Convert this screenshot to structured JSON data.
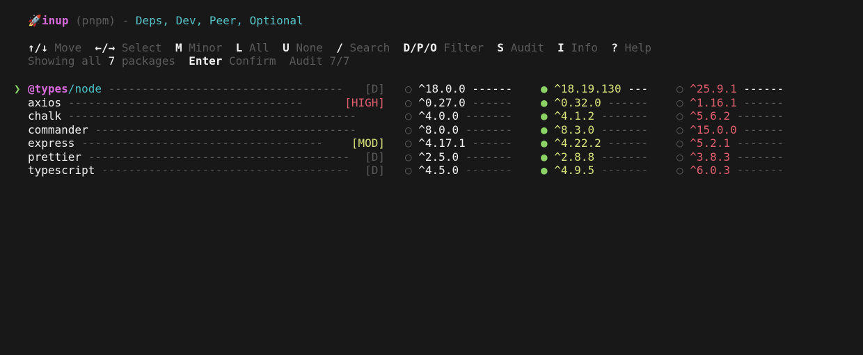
{
  "header": {
    "rocket_icon": "🚀",
    "app_name": "inup",
    "pkg_manager": "(pnpm)",
    "sep": " - ",
    "dep_types": "Deps, Dev, Peer, Optional"
  },
  "help": {
    "row1": [
      {
        "key": "↑/↓",
        "label": "Move"
      },
      {
        "key": "←/→",
        "label": "Select"
      },
      {
        "key": "M",
        "label": "Minor"
      },
      {
        "key": "L",
        "label": "All"
      },
      {
        "key": "U",
        "label": "None"
      },
      {
        "key": "/",
        "label": "Search"
      },
      {
        "key": "D/P/O",
        "label": "Filter"
      },
      {
        "key": "S",
        "label": "Audit"
      },
      {
        "key": "I",
        "label": "Info"
      },
      {
        "key": "?",
        "label": "Help"
      }
    ],
    "row2": {
      "showing_prefix": "Showing all",
      "count": "7",
      "showing_suffix": "packages",
      "enter_key": "Enter",
      "enter_label": "Confirm",
      "audit_status": "Audit 7/7"
    }
  },
  "cursor_glyph": "❯",
  "packages": [
    {
      "scope": "@types",
      "slash": "/",
      "name": "node",
      "dashes": " -----------------------------------",
      "tag": "[D]",
      "tag_color": "#5a5a5a",
      "current": "^18.0.0",
      "cur_dashes": " ------",
      "minor": "^18.19.130",
      "minor_dashes": " ---",
      "latest": "^25.9.1",
      "latest_dashes": " ------",
      "minor_selected": true,
      "cursor": true
    },
    {
      "scope": "",
      "slash": "",
      "name": "axios",
      "dashes": " ----------------------------------- ",
      "tag": "[HIGH]",
      "tag_color": "#e05f6f",
      "current": "^0.27.0",
      "cur_dashes": " ------",
      "minor": "^0.32.0",
      "minor_dashes": " ------",
      "latest": "^1.16.1",
      "latest_dashes": " ------",
      "minor_selected": true,
      "cursor": false
    },
    {
      "scope": "",
      "slash": "",
      "name": "chalk",
      "dashes": " -------------------------------------------",
      "tag": "",
      "tag_color": "#5a5a5a",
      "current": "^4.0.0",
      "cur_dashes": " -------",
      "minor": "^4.1.2",
      "minor_dashes": " -------",
      "latest": "^5.6.2",
      "latest_dashes": " -------",
      "minor_selected": true,
      "cursor": false
    },
    {
      "scope": "",
      "slash": "",
      "name": "commander",
      "dashes": " ---------------------------------------",
      "tag": "",
      "tag_color": "#5a5a5a",
      "current": "^8.0.0",
      "cur_dashes": " -------",
      "minor": "^8.3.0",
      "minor_dashes": " -------",
      "latest": "^15.0.0",
      "latest_dashes": " ------",
      "minor_selected": true,
      "cursor": false
    },
    {
      "scope": "",
      "slash": "",
      "name": "express",
      "dashes": " ------------------------------------ ",
      "tag": "[MOD]",
      "tag_color": "#d6e07a",
      "current": "^4.17.1",
      "cur_dashes": " ------",
      "minor": "^4.22.2",
      "minor_dashes": " ------",
      "latest": "^5.2.1",
      "latest_dashes": " -------",
      "minor_selected": true,
      "cursor": false
    },
    {
      "scope": "",
      "slash": "",
      "name": "prettier",
      "dashes": " ---------------------------------------",
      "tag": "[D]",
      "tag_color": "#5a5a5a",
      "current": "^2.5.0",
      "cur_dashes": " -------",
      "minor": "^2.8.8",
      "minor_dashes": " -------",
      "latest": "^3.8.3",
      "latest_dashes": " -------",
      "minor_selected": true,
      "cursor": false
    },
    {
      "scope": "",
      "slash": "",
      "name": "typescript",
      "dashes": " -------------------------------------",
      "tag": "[D]",
      "tag_color": "#5a5a5a",
      "current": "^4.5.0",
      "cur_dashes": " -------",
      "minor": "^4.9.5",
      "minor_dashes": " -------",
      "latest": "^6.0.3",
      "latest_dashes": " -------",
      "minor_selected": true,
      "cursor": false
    }
  ],
  "radio_empty": "○",
  "radio_filled": "●",
  "colors": {
    "background": "#181818",
    "cyan": "#56c2c6",
    "magenta": "#d46ad8",
    "yellow": "#d6e07a",
    "red": "#e05f6f",
    "green": "#8ad264",
    "dim": "#5a5a5a"
  }
}
